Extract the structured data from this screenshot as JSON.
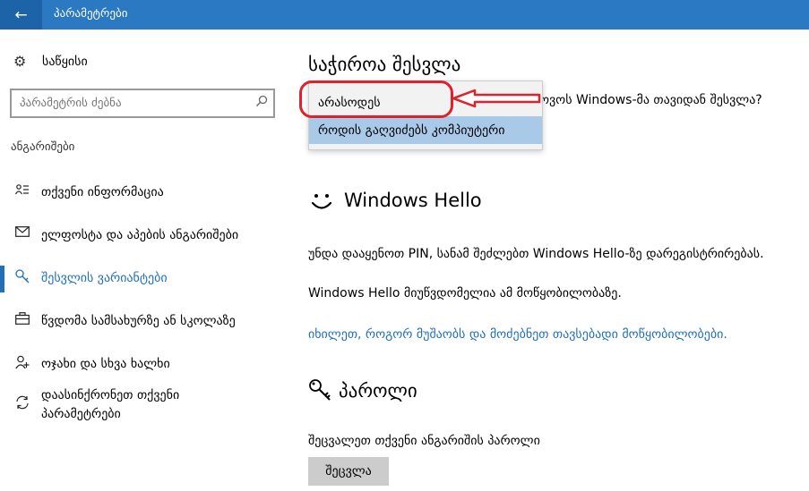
{
  "titlebar": {
    "back_icon": "arrow-left-icon",
    "title": "პარამეტრები"
  },
  "sidebar": {
    "home_label": "საწყისი",
    "search_placeholder": "პარამეტრის ძებნა",
    "section": "ანგარიშები",
    "items": [
      {
        "label": "თქვენი ინფორმაცია",
        "icon": "person-card-icon"
      },
      {
        "label": "ელფოსტა და აპების ანგარიშები",
        "icon": "mail-icon"
      },
      {
        "label": "შესვლის ვარიანტები",
        "icon": "key-icon",
        "active": true
      },
      {
        "label": "წვდომა სამსახურზე ან სკოლაზე",
        "icon": "briefcase-icon"
      },
      {
        "label": "ოჯახი და სხვა ხალხი",
        "icon": "person-add-icon"
      },
      {
        "label": "დაასინქრონეთ თქვენი",
        "label2": "პარამეტრები",
        "icon": "sync-icon"
      }
    ]
  },
  "main": {
    "signin_title": "საჭიროა შესვლა",
    "signin_question": "ოვოს Windows-მა თავიდან შესვლა?",
    "dropdown": {
      "options": [
        "არასოდეს",
        "როდის გაღვიძებს კომპიუტერი"
      ],
      "selected_index": 1
    },
    "hello_title": "Windows Hello",
    "hello_para1": "უნდა დააყენოთ PIN, სანამ შეძლებთ Windows Hello-ზე დარეგისტრირებას.",
    "hello_para2": "Windows Hello მიუწვდომელია ამ მოწყობილობაზე.",
    "hello_link": "იხილეთ, როგორ მუშაობს და მოძებნეთ თავსებადი მოწყობილობები.",
    "password_title": "პაროლი",
    "password_para": "შეცვალეთ თქვენი ანგარიშის პაროლი",
    "password_button": "შეცვლა"
  },
  "colors": {
    "accent": "#1f6fbd",
    "titlebar": "#2b79c2",
    "annotation": "#e0202a"
  }
}
